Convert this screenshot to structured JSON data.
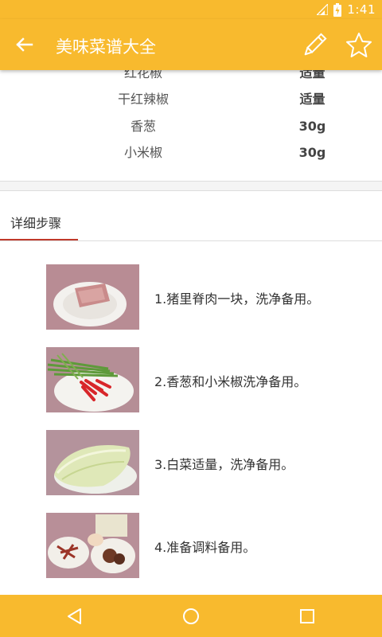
{
  "status_bar": {
    "time": "1:41"
  },
  "app_bar": {
    "title": "美味菜谱大全"
  },
  "ingredients": [
    {
      "name": "红花椒",
      "amount": "适量"
    },
    {
      "name": "干红辣椒",
      "amount": "适量"
    },
    {
      "name": "香葱",
      "amount": "30g"
    },
    {
      "name": "小米椒",
      "amount": "30g"
    }
  ],
  "tab": {
    "label": "详细步骤"
  },
  "steps": [
    {
      "text": "1.猪里脊肉一块，洗净备用。"
    },
    {
      "text": "2.香葱和小米椒洗净备用。"
    },
    {
      "text": "3.白菜适量，洗净备用。"
    },
    {
      "text": "4.准备调料备用。"
    }
  ],
  "colors": {
    "accent": "#f8ba2e",
    "tab_indicator": "#c0392b"
  }
}
